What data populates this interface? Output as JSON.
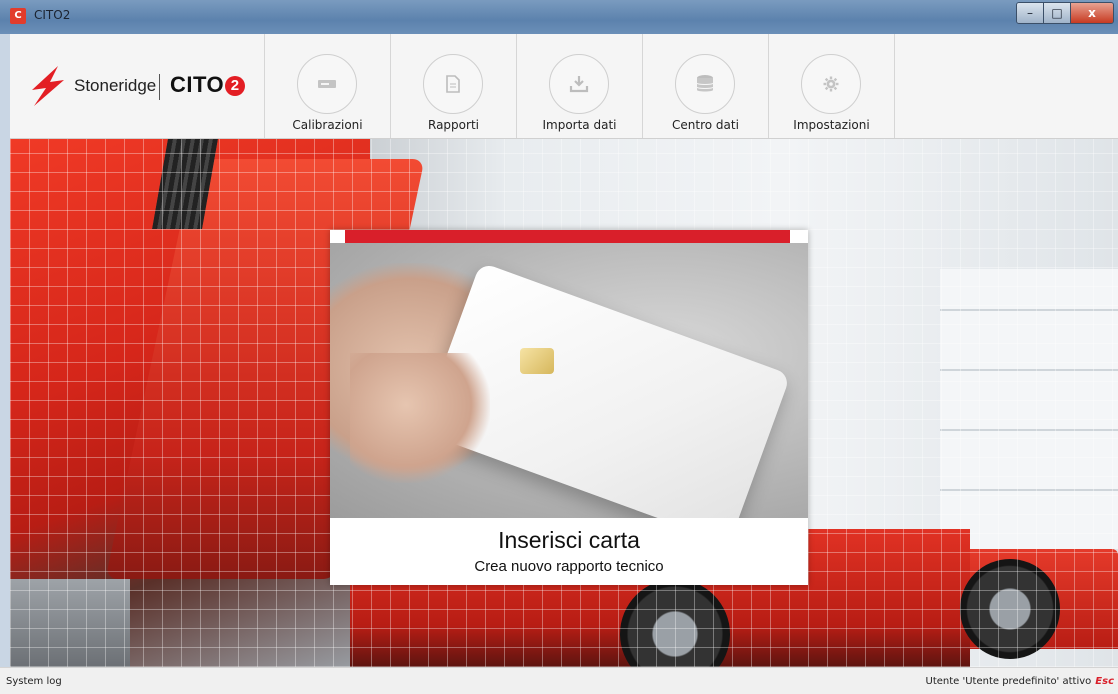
{
  "window": {
    "title": "CITO2",
    "app_icon": "C",
    "minimize_label": "–",
    "maximize_label": "□",
    "close_label": "x"
  },
  "logo": {
    "brand": "Stoneridge",
    "product": "CITO",
    "product_suffix": "2"
  },
  "nav": {
    "items": [
      {
        "label": "Calibrazioni",
        "icon": "card-slot-icon"
      },
      {
        "label": "Rapporti",
        "icon": "document-icon"
      },
      {
        "label": "Importa dati",
        "icon": "download-icon"
      },
      {
        "label": "Centro dati",
        "icon": "database-icon"
      },
      {
        "label": "Impostazioni",
        "icon": "gear-icon"
      }
    ]
  },
  "dialog": {
    "title": "Inserisci carta",
    "subtitle": "Crea nuovo rapporto tecnico",
    "accent_color": "#d91f2a"
  },
  "status": {
    "left": "System log",
    "right": "Utente 'Utente predefinito' attivo",
    "right_action": "Esc"
  }
}
